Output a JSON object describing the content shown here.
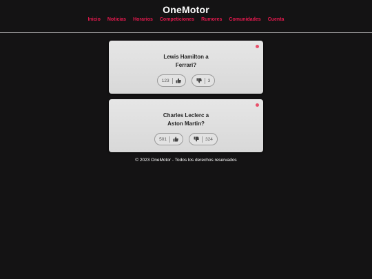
{
  "header": {
    "title": "OneMotor",
    "nav": [
      "Inicio",
      "Noticias",
      "Horarios",
      "Competiciones",
      "Rumores",
      "Comunidades",
      "Cuenta"
    ]
  },
  "cards": [
    {
      "question_line1": "Lewis Hamilton a",
      "question_line2": "Ferrari?",
      "likes": "123",
      "dislikes": "3"
    },
    {
      "question_line1": "Charles Leclerc a",
      "question_line2": "Aston Martin?",
      "likes": "501",
      "dislikes": "324"
    }
  ],
  "footer": {
    "text": "© 2023 OneMotor - Todos los derechos reservados"
  },
  "colors": {
    "background": "#141314",
    "nav_link": "#e8194f",
    "card": "#e0e0e0",
    "status_dot": "#e8506a"
  },
  "icons": [
    "thumbs-up-icon",
    "thumbs-down-icon"
  ]
}
